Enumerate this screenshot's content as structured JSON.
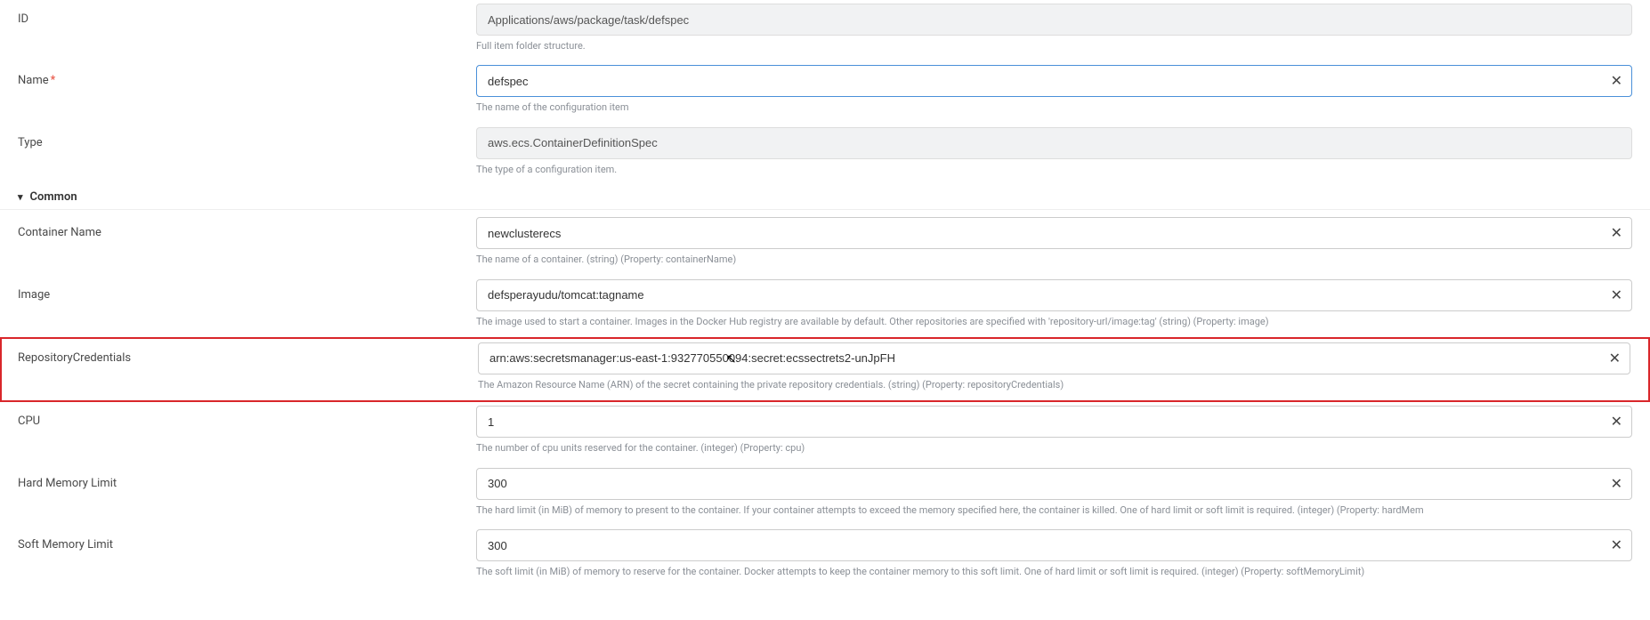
{
  "fields": {
    "id": {
      "label": "ID",
      "value": "Applications/aws/package/task/defspec",
      "help": "Full item folder structure."
    },
    "name": {
      "label": "Name",
      "value": "defspec",
      "help": "The name of the configuration item"
    },
    "type": {
      "label": "Type",
      "value": "aws.ecs.ContainerDefinitionSpec",
      "help": "The type of a configuration item."
    },
    "containerName": {
      "label": "Container Name",
      "value": "newclusterecs",
      "help": "The name of a container. (string) (Property: containerName)"
    },
    "image": {
      "label": "Image",
      "value": "defsperayudu/tomcat:tagname",
      "help": "The image used to start a container. Images in the Docker Hub registry are available by default. Other repositories are specified with 'repository-url/image:tag' (string) (Property: image)"
    },
    "repositoryCredentials": {
      "label": "RepositoryCredentials",
      "value": "arn:aws:secretsmanager:us-east-1:932770550094:secret:ecssectrets2-unJpFH",
      "help": "The Amazon Resource Name (ARN) of the secret containing the private repository credentials. (string) (Property: repositoryCredentials)"
    },
    "cpu": {
      "label": "CPU",
      "value": "1",
      "help": "The number of cpu units reserved for the container. (integer) (Property: cpu)"
    },
    "hardMemoryLimit": {
      "label": "Hard Memory Limit",
      "value": "300",
      "help": "The hard limit (in MiB) of memory to present to the container. If your container attempts to exceed the memory specified here, the container is killed. One of hard limit or soft limit is required. (integer) (Property: hardMem"
    },
    "softMemoryLimit": {
      "label": "Soft Memory Limit",
      "value": "300",
      "help": "The soft limit (in MiB) of memory to reserve for the container. Docker attempts to keep the container memory to this soft limit. One of hard limit or soft limit is required. (integer) (Property: softMemoryLimit)"
    }
  },
  "section": {
    "common": "Common"
  }
}
